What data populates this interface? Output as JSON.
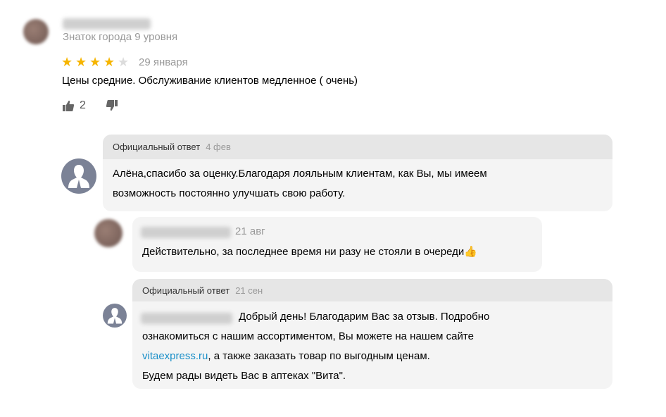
{
  "review": {
    "author_level": "Знаток города 9 уровня",
    "rating": 4,
    "rating_max": 5,
    "date": "29 января",
    "text": "Цены средние. Обслуживание клиентов медленное ( очень)",
    "likes": "2"
  },
  "official_reply_1": {
    "label": "Официальный ответ",
    "date": "4 фев",
    "line1": "Алёна,спасибо за оценку.Благодаря лояльным клиентам, как Вы, мы имеем",
    "line2": "возможность постоянно улучшать свою работу."
  },
  "user_comment": {
    "date": "21 авг",
    "text": "Действительно, за последнее время ни разу не стояли в очереди",
    "emoji": "👍"
  },
  "official_reply_2": {
    "label": "Официальный ответ",
    "date": "21 сен",
    "line1": "Добрый день! Благодарим Вас за отзыв. Подробно",
    "line2": "ознакомиться с нашим ассортиментом, Вы можете на нашем сайте",
    "link": "vitaexpress.ru",
    "line3_rest": ", а также заказать товар по выгодным ценам.",
    "line4": "Будем рады видеть Вас в аптеках \"Вита\"."
  },
  "colors": {
    "star_on": "#f6b500",
    "star_off": "#dcdcdc",
    "link": "#1a8fc8",
    "bubble_bg": "#f4f4f4",
    "bubble_header_bg": "#e6e6e6"
  },
  "icons": [
    "thumbs-up-icon",
    "thumbs-down-icon",
    "org-silhouette-icon",
    "thumbs-up-emoji"
  ]
}
